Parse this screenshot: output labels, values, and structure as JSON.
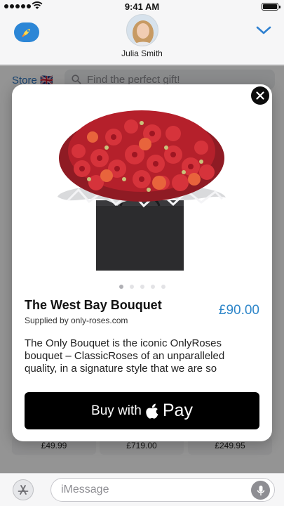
{
  "status": {
    "time": "9:41 AM"
  },
  "header": {
    "contact_name": "Julia Smith"
  },
  "store": {
    "label": "Store 🇬🇧",
    "search_placeholder": "Find the perfect gift!",
    "prices": [
      "£49.99",
      "£719.00",
      "£249.95"
    ]
  },
  "product": {
    "title": "The West Bay Bouquet",
    "supplier": "Supplied by only-roses.com",
    "price": "£90.00",
    "description": "The Only Bouquet is the iconic OnlyRoses bouquet – ClassicRoses of an unparalleled quality, in a signature style that we are so",
    "image_count": 5,
    "active_image": 1
  },
  "buy_button": {
    "label": "Buy with",
    "pay_label": "Pay"
  },
  "message_bar": {
    "placeholder": "iMessage"
  },
  "colors": {
    "accent": "#2e86c9",
    "app_icon": "#2c86d6",
    "buy_bg": "#000000"
  },
  "icons": [
    "signal-icon",
    "wifi-icon",
    "battery-icon",
    "rocket-icon",
    "chevron-down-icon",
    "search-icon",
    "close-icon",
    "apple-logo-icon",
    "app-store-icon",
    "microphone-icon"
  ]
}
